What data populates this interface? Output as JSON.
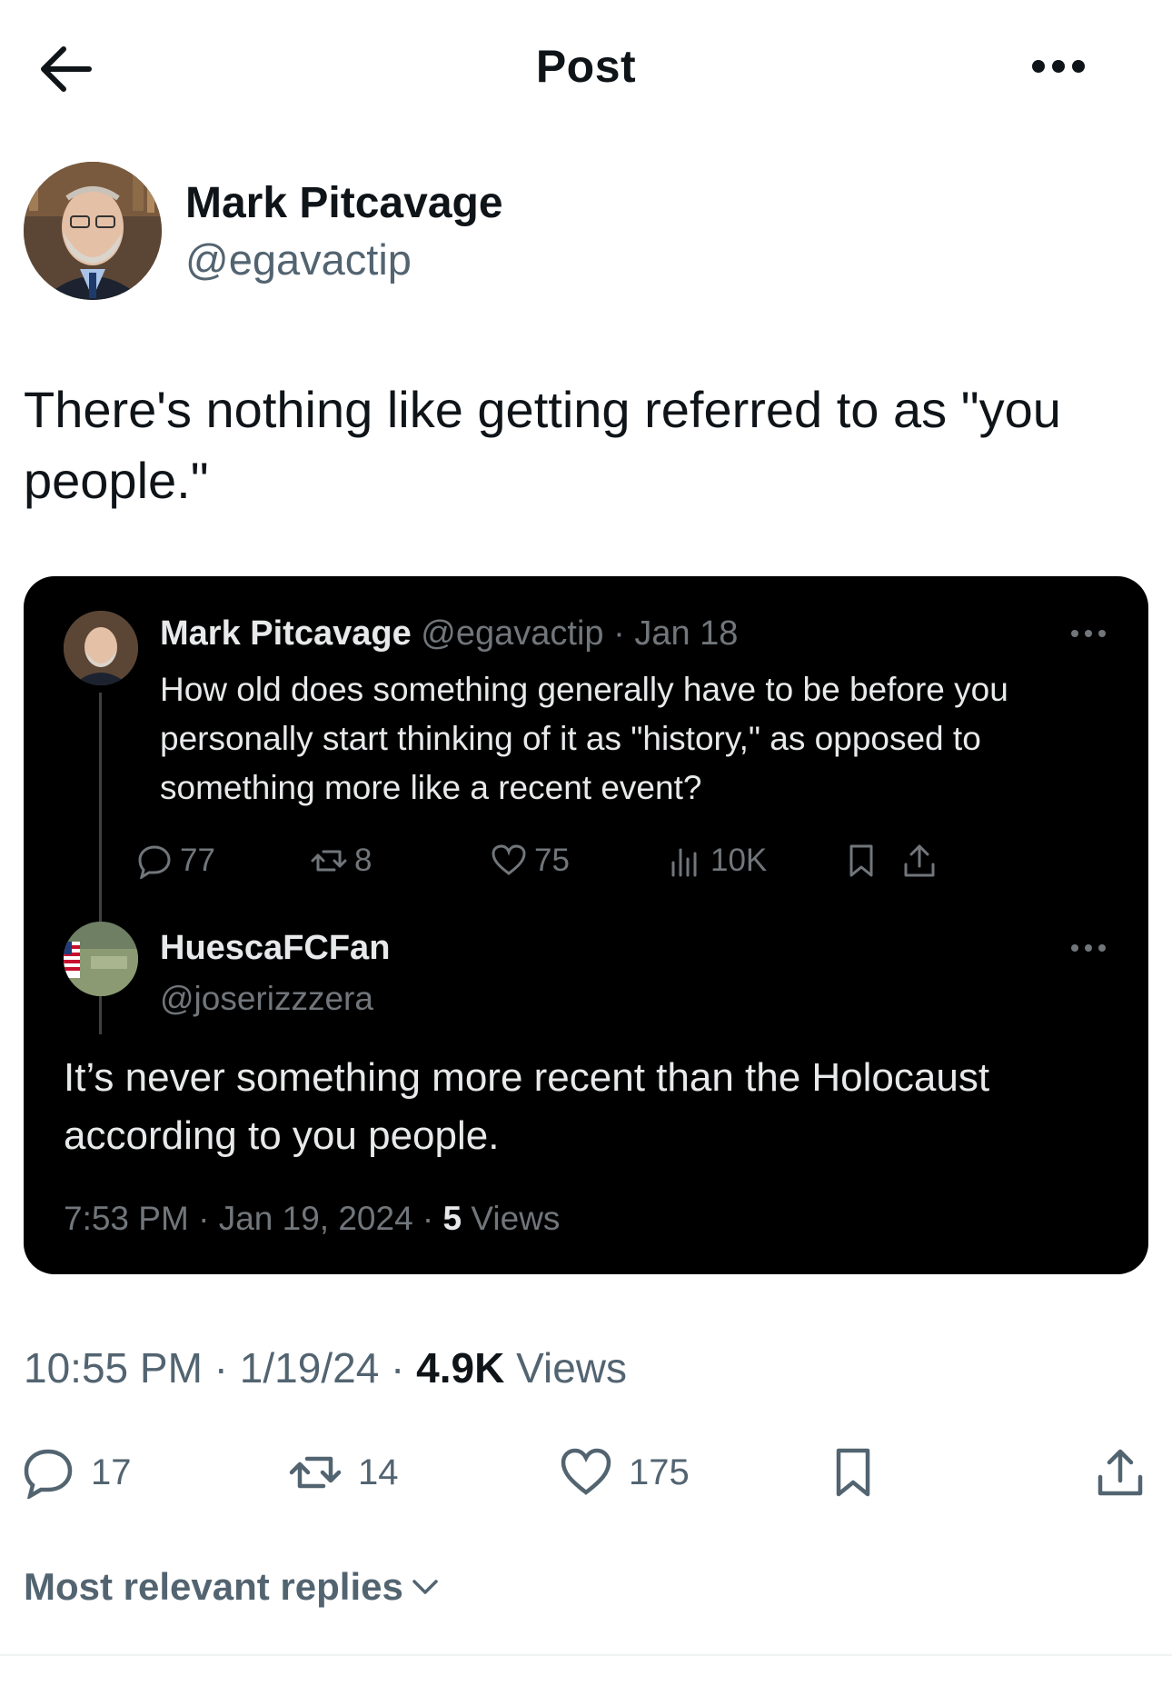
{
  "header": {
    "title": "Post",
    "back_icon": "arrow-left-icon",
    "more_icon": "more-horizontal-icon"
  },
  "author": {
    "name": "Mark Pitcavage",
    "handle": "@egavactip"
  },
  "post": {
    "text": "There's nothing like getting referred to as \"you people.\""
  },
  "embedded": {
    "original": {
      "name": "Mark Pitcavage",
      "handle": "@egavactip",
      "separator": "·",
      "date": "Jan 18",
      "text": "How old does something generally have to be before you personally start thinking of it as \"history,\" as opposed to something more like a recent event?",
      "stats": {
        "replies": "77",
        "reposts": "8",
        "likes": "75",
        "views": "10K"
      }
    },
    "reply": {
      "name": "HuescaFCFan",
      "handle": "@joserizzzera",
      "text": "It’s never something more recent than the Holocaust according to you people.",
      "time": "7:53 PM",
      "date": "Jan 19, 2024",
      "views_count": "5",
      "views_label": "Views"
    }
  },
  "meta": {
    "time": "10:55 PM",
    "date": "1/19/24",
    "views_count": "4.9K",
    "views_label": "Views"
  },
  "stats": {
    "replies": "17",
    "reposts": "14",
    "likes": "175"
  },
  "replies_sort": {
    "label": "Most relevant replies"
  },
  "colors": {
    "text": "#0f1419",
    "secondary": "#536471",
    "embed_bg": "#000000",
    "embed_text": "#e7e9ea",
    "embed_secondary": "#71767b"
  }
}
